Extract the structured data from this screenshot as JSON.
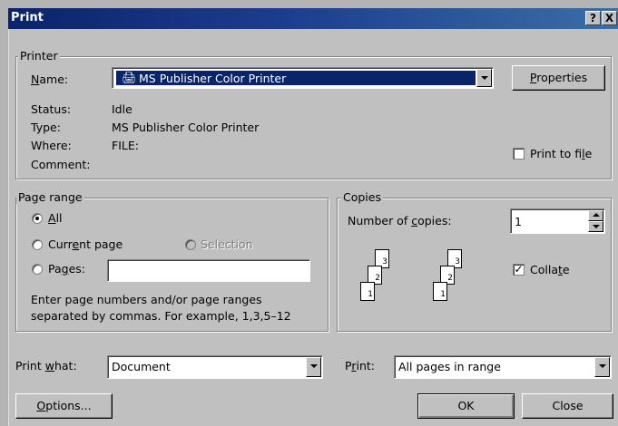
{
  "window": {
    "title": "Print",
    "help_label": "?",
    "close_label": "X"
  },
  "printer": {
    "legend": "Printer",
    "name_label": "Name:",
    "name_value": "MS Publisher Color Printer",
    "properties_label": "Properties",
    "status_label": "Status:",
    "status_value": "Idle",
    "type_label": "Type:",
    "type_value": "MS Publisher Color Printer",
    "where_label": "Where:",
    "where_value": "FILE:",
    "comment_label": "Comment:",
    "print_to_file_label": "Print to file",
    "print_to_file_checked": false
  },
  "page_range": {
    "legend": "Page range",
    "all_label": "All",
    "current_page_label": "Current page",
    "selection_label": "Selection",
    "pages_label": "Pages:",
    "pages_value": "",
    "selected": "all",
    "hint_line1": "Enter page numbers and/or page ranges",
    "hint_line2": "separated by commas.  For example, 1,3,5–12"
  },
  "copies": {
    "legend": "Copies",
    "number_label": "Number of copies:",
    "number_value": "1",
    "collate_label": "Collate",
    "collate_checked": true,
    "stack_numbers": [
      "3",
      "2",
      "1"
    ]
  },
  "bottom": {
    "print_what_label": "Print what:",
    "print_what_value": "Document",
    "print_label": "Print:",
    "print_value": "All pages in range",
    "options_label": "Options...",
    "ok_label": "OK",
    "close_label": "Close"
  },
  "colors": {
    "title_bar": "#0a246a",
    "dialog_face": "#c0c0c0",
    "selection_highlight": "#0a246a"
  }
}
